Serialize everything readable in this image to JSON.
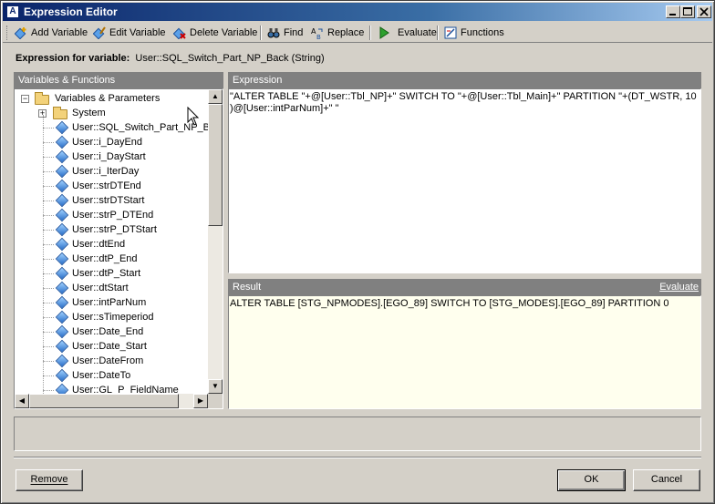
{
  "window": {
    "title": "Expression Editor",
    "title_icon_glyph": "A"
  },
  "toolbar": {
    "add_variable": "Add Variable",
    "edit_variable": "Edit Variable",
    "delete_variable": "Delete Variable",
    "find": "Find",
    "replace": "Replace",
    "evaluate": "Evaluate",
    "functions": "Functions"
  },
  "expression_for": {
    "label": "Expression for variable:",
    "value": "User::SQL_Switch_Part_NP_Back (String)"
  },
  "left_panel": {
    "title": "Variables & Functions",
    "root": "Variables & Parameters",
    "system": "System",
    "variables": [
      "User::SQL_Switch_Part_NP_B...",
      "User::i_DayEnd",
      "User::i_DayStart",
      "User::i_IterDay",
      "User::strDTEnd",
      "User::strDTStart",
      "User::strP_DTEnd",
      "User::strP_DTStart",
      "User::dtEnd",
      "User::dtP_End",
      "User::dtP_Start",
      "User::dtStart",
      "User::intParNum",
      "User::sTimeperiod",
      "User::Date_End",
      "User::Date_Start",
      "User::DateFrom",
      "User::DateTo",
      "User::GL_P_FieldName"
    ]
  },
  "expression": {
    "title": "Expression",
    "text": "\"ALTER TABLE \"+@[User::Tbl_NP]+\" SWITCH TO \"+@[User::Tbl_Main]+\" PARTITION \"+(DT_WSTR, 10 )@[User::intParNum]+\" \""
  },
  "result": {
    "title": "Result",
    "evaluate_link": "Evaluate",
    "text": "ALTER TABLE [STG_NPMODES].[EGO_89] SWITCH TO [STG_MODES].[EGO_89] PARTITION 0"
  },
  "buttons": {
    "remove": "Remove",
    "ok": "OK",
    "cancel": "Cancel"
  },
  "colors": {
    "titlebar_start": "#0a246a",
    "panel_header": "#808080",
    "result_bg": "#ffffee",
    "dialog_bg": "#d4d0c8"
  }
}
